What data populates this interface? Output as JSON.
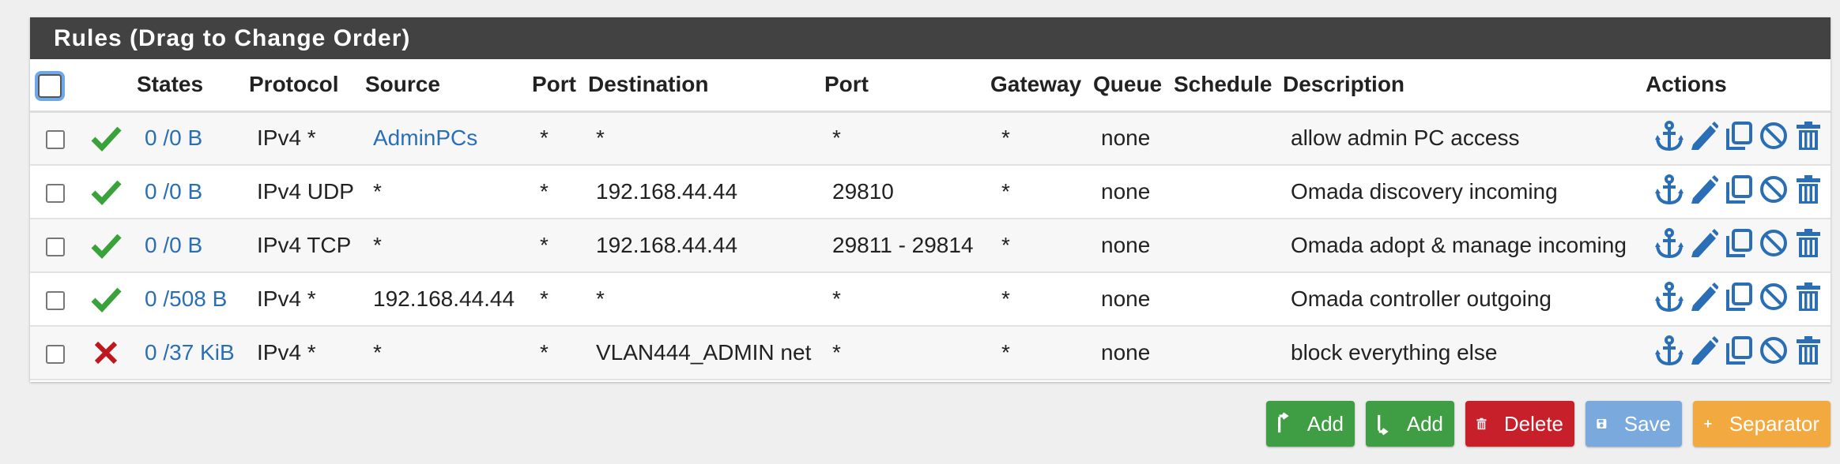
{
  "panel": {
    "title": "Rules (Drag to Change Order)"
  },
  "table": {
    "headers": {
      "states": "States",
      "protocol": "Protocol",
      "source": "Source",
      "port": "Port",
      "destination": "Destination",
      "dest_port": "Port",
      "gateway": "Gateway",
      "queue": "Queue",
      "schedule": "Schedule",
      "description": "Description",
      "actions": "Actions"
    },
    "rows": [
      {
        "status": "pass",
        "states": "0 /0 B",
        "protocol": "IPv4 *",
        "source": "AdminPCs",
        "port": "*",
        "destination": "*",
        "dest_port": "*",
        "gateway": "*",
        "queue": "none",
        "schedule": "",
        "description": "allow admin PC access"
      },
      {
        "status": "pass",
        "states": "0 /0 B",
        "protocol": "IPv4 UDP",
        "source": "*",
        "port": "*",
        "destination": "192.168.44.44",
        "dest_port": "29810",
        "gateway": "*",
        "queue": "none",
        "schedule": "",
        "description": "Omada discovery incoming"
      },
      {
        "status": "pass",
        "states": "0 /0 B",
        "protocol": "IPv4 TCP",
        "source": "*",
        "port": "*",
        "destination": "192.168.44.44",
        "dest_port": "29811 - 29814",
        "gateway": "*",
        "queue": "none",
        "schedule": "",
        "description": "Omada adopt & manage incoming"
      },
      {
        "status": "pass",
        "states": "0 /508 B",
        "protocol": "IPv4 *",
        "source": "192.168.44.44",
        "port": "*",
        "destination": "*",
        "dest_port": "*",
        "gateway": "*",
        "queue": "none",
        "schedule": "",
        "description": "Omada controller outgoing"
      },
      {
        "status": "block",
        "states": "0 /37 KiB",
        "protocol": "IPv4 *",
        "source": "*",
        "port": "*",
        "destination": "VLAN444_ADMIN net",
        "dest_port": "*",
        "gateway": "*",
        "queue": "none",
        "schedule": "",
        "description": "block everything else"
      }
    ],
    "action_icons": [
      "anchor-icon",
      "pencil-icon",
      "copy-icon",
      "disable-icon",
      "trash-icon"
    ]
  },
  "buttons": {
    "add_top": "Add",
    "add_bottom": "Add",
    "delete": "Delete",
    "save": "Save",
    "separator": "Separator"
  },
  "colors": {
    "link": "#2a6fb6",
    "pass": "#3aa23a",
    "block": "#c0171f",
    "green_button": "#3f9d43",
    "red_button": "#c8202a",
    "blue_button": "#79a9dd",
    "orange_button": "#f2a940",
    "heading": "#424242"
  }
}
